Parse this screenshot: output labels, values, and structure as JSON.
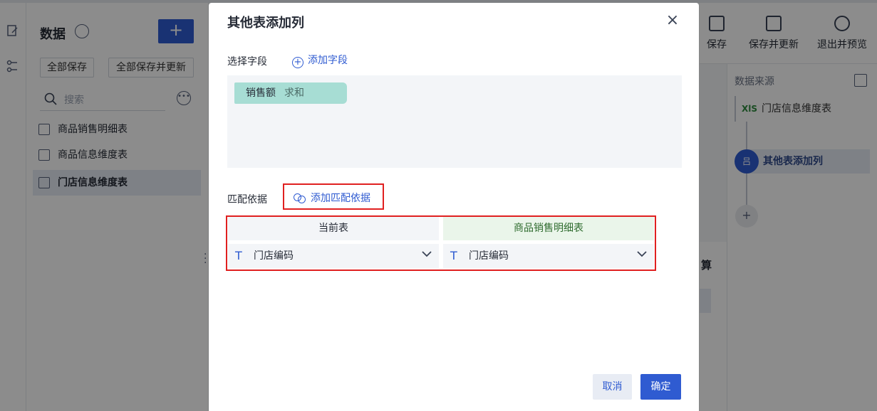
{
  "datapanel": {
    "title": "数据",
    "save_all": "全部保存",
    "save_all_update": "全部保存并更新",
    "search_placeholder": "搜索",
    "items": [
      {
        "label": "商品销售明细表"
      },
      {
        "label": "商品信息维度表"
      },
      {
        "label": "门店信息维度表"
      }
    ],
    "add_label": "+"
  },
  "toolbar": {
    "save": "保存",
    "save_update": "保存并更新",
    "exit_preview": "退出并预览"
  },
  "rightpanel": {
    "title": "数据来源",
    "source_badge": "XlS",
    "source": "门店信息维度表",
    "step": "其他表添加列",
    "step_icon": "吕",
    "add_step": "+"
  },
  "midcol": {
    "calc": "算"
  },
  "dialog": {
    "title": "其他表添加列",
    "close": "×",
    "select_field_label": "选择字段",
    "add_field": "添加字段",
    "field_chip": {
      "name": "销售额",
      "agg": "求和"
    },
    "match_label": "匹配依据",
    "add_match": "添加匹配依据",
    "left_table": "当前表",
    "right_table": "商品销售明细表",
    "left_field": "门店编码",
    "right_field": "门店编码",
    "type_icon": "T",
    "chevron": "⌄",
    "cancel": "取消",
    "ok": "确定"
  }
}
